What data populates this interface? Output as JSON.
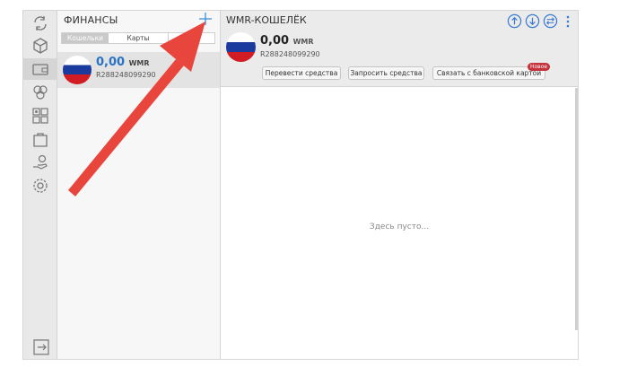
{
  "sidebar": {
    "items": [
      {
        "icon": "sync-icon"
      },
      {
        "icon": "cube-icon"
      },
      {
        "icon": "wallet-icon",
        "active": true
      },
      {
        "icon": "coins-icon"
      },
      {
        "icon": "qr-grid-icon"
      },
      {
        "icon": "shopping-bag-icon"
      },
      {
        "icon": "hand-coin-icon"
      },
      {
        "icon": "gear-icon"
      }
    ],
    "bottom_icon": "exit-icon"
  },
  "finance": {
    "title": "ФИНАНСЫ",
    "add_icon": "plus-icon",
    "tabs": [
      {
        "label": "Кошельки",
        "active": true
      },
      {
        "label": "Карты",
        "active": false
      }
    ],
    "wallet": {
      "balance": "0,00",
      "currency": "WMR",
      "number": "R288248099290",
      "flag": "russia-flag-icon"
    }
  },
  "main": {
    "title": "WMR-КОШЕЛЁК",
    "balance": "0,00",
    "currency": "WMR",
    "number": "R288248099290",
    "buttons": {
      "transfer": "Перевести средства",
      "request": "Запросить средства",
      "link_card": "Связать с банковской картой"
    },
    "new_badge": "Новое",
    "empty_text": "Здесь пусто...",
    "header_icons": [
      "send-coin-icon",
      "receive-coin-icon",
      "exchange-icon",
      "kebab-menu-icon"
    ]
  },
  "colors": {
    "accent": "#2a73c4",
    "badge": "#c4323b",
    "arrow": "#e8453c"
  },
  "annotation": {
    "type": "arrow",
    "points_to": "plus-icon"
  }
}
